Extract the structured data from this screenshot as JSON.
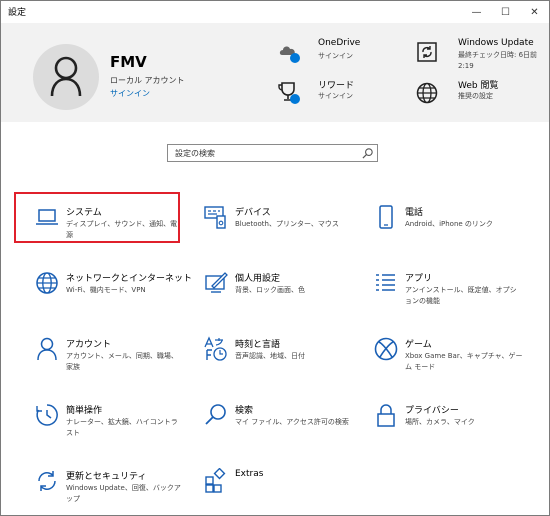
{
  "window": {
    "title": "設定",
    "minimize": "—",
    "maximize": "☐",
    "close": "✕"
  },
  "account": {
    "name": "FMV",
    "type": "ローカル アカウント",
    "signin": "サインイン"
  },
  "header_items": {
    "onedrive": {
      "title": "OneDrive",
      "sub": "サインイン"
    },
    "reward": {
      "title": "リワード",
      "sub": "サインイン"
    },
    "windows_update": {
      "title": "Windows Update",
      "sub1": "最終チェック日時: 6日前",
      "sub2": "2:19"
    },
    "web_browse": {
      "title": "Web 閲覧",
      "sub": "推奨の設定"
    }
  },
  "search": {
    "placeholder": "設定の検索"
  },
  "tiles": [
    {
      "title": "システム",
      "desc": "ディスプレイ、サウンド、通知、電源",
      "icon": "laptop-icon"
    },
    {
      "title": "デバイス",
      "desc": "Bluetooth、プリンター、マウス",
      "icon": "devices-icon"
    },
    {
      "title": "電話",
      "desc": "Android、iPhone のリンク",
      "icon": "phone-icon"
    },
    {
      "title": "ネットワークとインターネット",
      "desc": "Wi-Fi、機内モード、VPN",
      "icon": "globe-icon"
    },
    {
      "title": "個人用設定",
      "desc": "背景、ロック画面、色",
      "icon": "personalization-icon"
    },
    {
      "title": "アプリ",
      "desc": "アンインストール、既定値、オプションの機能",
      "icon": "apps-icon"
    },
    {
      "title": "アカウント",
      "desc": "アカウント、メール、同期、職場、家族",
      "icon": "person-icon"
    },
    {
      "title": "時刻と言語",
      "desc": "音声認識、地域、日付",
      "icon": "time-language-icon"
    },
    {
      "title": "ゲーム",
      "desc": "Xbox Game Bar、キャプチャ、ゲーム モード",
      "icon": "xbox-icon"
    },
    {
      "title": "簡単操作",
      "desc": "ナレーター、拡大鏡、ハイコントラスト",
      "icon": "ease-of-access-icon"
    },
    {
      "title": "検索",
      "desc": "マイ ファイル、アクセス許可の検索",
      "icon": "search-icon"
    },
    {
      "title": "プライバシー",
      "desc": "場所、カメラ、マイク",
      "icon": "lock-icon"
    },
    {
      "title": "更新とセキュリティ",
      "desc": "Windows Update、回復、バックアップ",
      "icon": "sync-icon"
    },
    {
      "title": "Extras",
      "desc": "",
      "icon": "extras-icon"
    }
  ],
  "colors": {
    "accent": "#0067b8",
    "icon_blue": "#1a5fb4",
    "selection": "#e0202b"
  }
}
